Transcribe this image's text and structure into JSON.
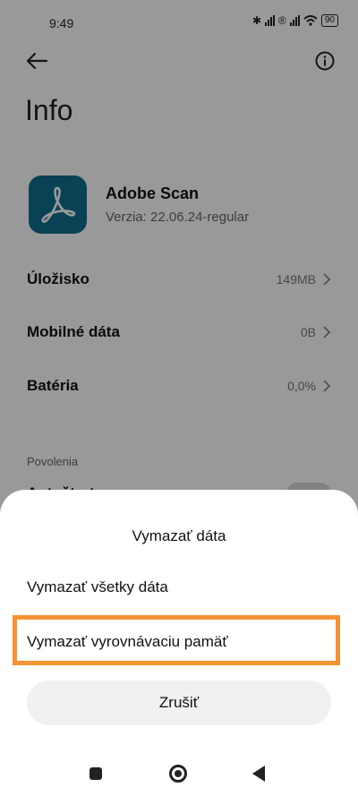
{
  "status_bar": {
    "time": "9:49",
    "battery": "90"
  },
  "header": {
    "title": "Info"
  },
  "app": {
    "name": "Adobe Scan",
    "version": "Verzia: 22.06.24-regular"
  },
  "rows": [
    {
      "label": "Úložisko",
      "value": "149MB"
    },
    {
      "label": "Mobilné dáta",
      "value": "0B"
    },
    {
      "label": "Batéria",
      "value": "0,0%"
    }
  ],
  "permissions": {
    "section_label": "Povolenia",
    "autostart_label": "Autoštart"
  },
  "dialog": {
    "title": "Vymazať dáta",
    "option_all": "Vymazať všetky dáta",
    "option_cache": "Vymazať vyrovnávaciu pamäť",
    "cancel": "Zrušiť",
    "highlight_color": "#f59233"
  }
}
